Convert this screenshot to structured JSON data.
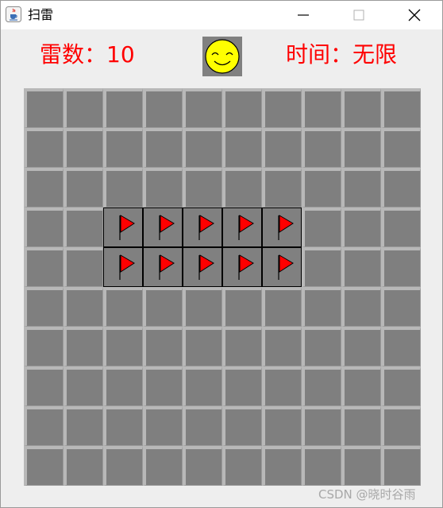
{
  "window": {
    "title": "扫雷",
    "app_icon": "java-cup-icon",
    "minimize_icon": "minimize-icon",
    "maximize_icon": "maximize-icon",
    "close_icon": "close-icon"
  },
  "header": {
    "mine_count_label": "雷数：10",
    "time_label": "时间：无限",
    "smiley_icon": "smiley-face-icon",
    "accent_color": "#ff0000"
  },
  "board": {
    "rows": 10,
    "cols": 10,
    "flag_icon": "red-flag-icon",
    "flagged_cells": [
      [
        3,
        2
      ],
      [
        3,
        3
      ],
      [
        3,
        4
      ],
      [
        3,
        5
      ],
      [
        3,
        6
      ],
      [
        4,
        2
      ],
      [
        4,
        3
      ],
      [
        4,
        4
      ],
      [
        4,
        5
      ],
      [
        4,
        6
      ]
    ]
  },
  "watermark": "CSDN @晓时谷雨"
}
